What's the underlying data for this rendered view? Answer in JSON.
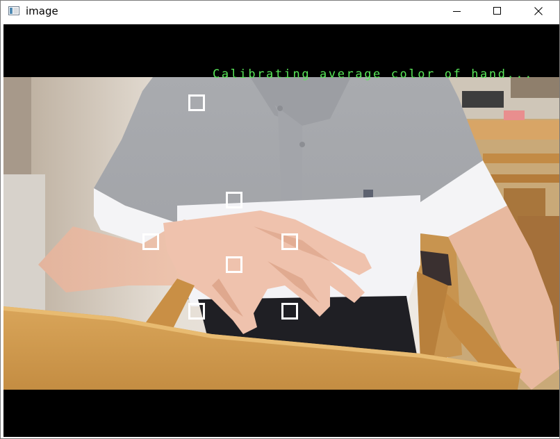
{
  "window": {
    "title": "image",
    "icon": "app-window-icon",
    "controls": {
      "minimize_icon": "minimize-icon",
      "maximize_icon": "maximize-icon",
      "close_icon": "close-icon"
    }
  },
  "overlay": {
    "status_text": "Calibrating average color of hand...",
    "status_color": "#59e659"
  },
  "sample_boxes": {
    "count": 7,
    "color": "#ffffff"
  }
}
